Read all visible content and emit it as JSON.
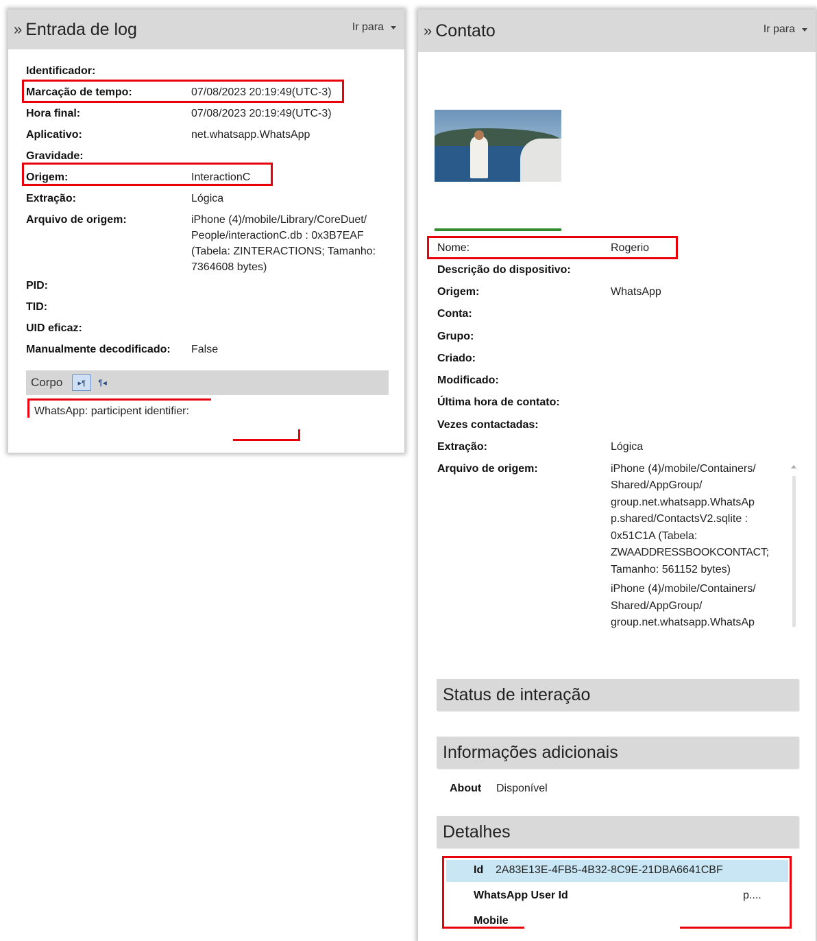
{
  "log_panel": {
    "title": "Entrada de log",
    "goto_label": "Ir para",
    "fields": [
      {
        "key": "Identificador:",
        "value": ""
      },
      {
        "key": "Marcação de tempo:",
        "value": "07/08/2023 20:19:49(UTC-3)"
      },
      {
        "key": "Hora final:",
        "value": "07/08/2023 20:19:49(UTC-3)"
      },
      {
        "key": "Aplicativo:",
        "value": "net.whatsapp.WhatsApp"
      },
      {
        "key": "Gravidade:",
        "value": ""
      },
      {
        "key": "Origem:",
        "value": "InteractionC"
      },
      {
        "key": "Extração:",
        "value": "Lógica"
      },
      {
        "key": "Arquivo de origem:",
        "value_lines": [
          "iPhone (4)/mobile/Library/CoreDuet/",
          "People/interactionC.db : 0x3B7EAF",
          "(Tabela: ZINTERACTIONS; Tamanho:",
          "7364608 bytes)"
        ]
      },
      {
        "key": "PID:",
        "value": ""
      },
      {
        "key": "TID:",
        "value": ""
      },
      {
        "key": "UID eficaz:",
        "value": ""
      },
      {
        "key": "Manualmente decodificado:",
        "value": "False"
      }
    ],
    "body_label": "Corpo",
    "body_text": "WhatsApp: participent identifier:"
  },
  "contact_panel": {
    "title": "Contato",
    "goto_label": "Ir para",
    "fields": [
      {
        "key": "Nome:",
        "value": "Rogerio"
      },
      {
        "key": "Descrição do dispositivo:",
        "value": ""
      },
      {
        "key": "Origem:",
        "value": "WhatsApp"
      },
      {
        "key": "Conta:",
        "value": ""
      },
      {
        "key": "Grupo:",
        "value": ""
      },
      {
        "key": "Criado:",
        "value": ""
      },
      {
        "key": "Modificado:",
        "value": ""
      },
      {
        "key": "Última hora de contato:",
        "value": ""
      },
      {
        "key": "Vezes contactadas:",
        "value": ""
      },
      {
        "key": "Extração:",
        "value": "Lógica"
      },
      {
        "key": "Arquivo de origem:",
        "value_lines": [
          "iPhone (4)/mobile/Containers/",
          "Shared/AppGroup/",
          "group.net.whatsapp.WhatsAp",
          "p.shared/ContactsV2.sqlite :",
          "0x51C1A (Tabela:",
          "ZWAADDRESSBOOKCONTACT;",
          "Tamanho: 561152 bytes)",
          "iPhone (4)/mobile/Containers/",
          "Shared/AppGroup/",
          "group.net.whatsapp.WhatsAp"
        ]
      }
    ],
    "sections": {
      "status": "Status de interação",
      "additional": "Informações adicionais",
      "details": "Detalhes"
    },
    "about": {
      "key": "About",
      "value": "Disponível"
    },
    "details_rows": [
      {
        "key": "Id",
        "value": "2A83E13E-4FB5-4B32-8C9E-21DBA6641CBF"
      },
      {
        "key": "WhatsApp User Id",
        "value": "p...."
      },
      {
        "key": "Mobile",
        "value": ""
      }
    ]
  },
  "colors": {
    "highlight_red": "#e8000b",
    "header_gray": "#d9d9d9",
    "selected_row": "#c9e6f5",
    "photo_underline": "#2e8b2e"
  }
}
